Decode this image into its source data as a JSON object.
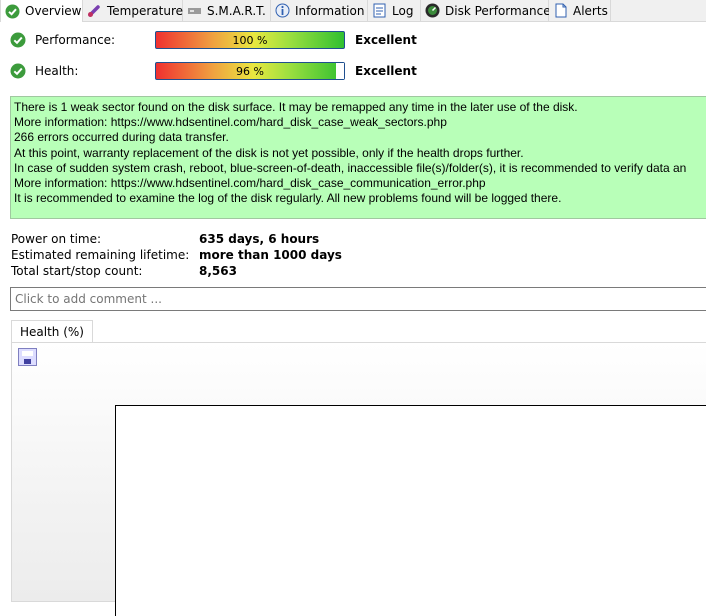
{
  "tabs": [
    {
      "label": "Overview",
      "icon": "check-icon",
      "active": true
    },
    {
      "label": "Temperature",
      "icon": "thermometer-icon"
    },
    {
      "label": "S.M.A.R.T.",
      "icon": "smart-icon"
    },
    {
      "label": "Information",
      "icon": "info-icon"
    },
    {
      "label": "Log",
      "icon": "log-icon"
    },
    {
      "label": "Disk Performance",
      "icon": "speedometer-icon"
    },
    {
      "label": "Alerts",
      "icon": "alerts-icon"
    }
  ],
  "performance": {
    "label": "Performance:",
    "value_text": "100 %",
    "value": 100,
    "rating": "Excellent"
  },
  "health": {
    "label": "Health:",
    "value_text": "96 %",
    "value": 96,
    "rating": "Excellent"
  },
  "messages": [
    "There is 1 weak sector found on the disk surface. It may be remapped any time in the later use of the disk.",
    "More information: https://www.hdsentinel.com/hard_disk_case_weak_sectors.php",
    "266 errors occurred during data transfer.",
    "At this point, warranty replacement of the disk is not yet possible, only if the health drops further.",
    "In case of sudden system crash, reboot, blue-screen-of-death, inaccessible file(s)/folder(s), it is recommended to verify data an",
    "More information: https://www.hdsentinel.com/hard_disk_case_communication_error.php",
    "It is recommended to examine the log of the disk regularly. All new problems found will be logged there."
  ],
  "info": [
    {
      "label": "Power on time:",
      "value": "635 days, 6 hours"
    },
    {
      "label": "Estimated remaining lifetime:",
      "value": "more than 1000 days"
    },
    {
      "label": "Total start/stop count:",
      "value": "8,563"
    }
  ],
  "comment": {
    "placeholder": "Click to add comment ..."
  },
  "chart_tab": {
    "label": "Health (%)"
  },
  "colors": {
    "message_bg": "#b8ffb8",
    "check_green": "#3c9b3c"
  }
}
